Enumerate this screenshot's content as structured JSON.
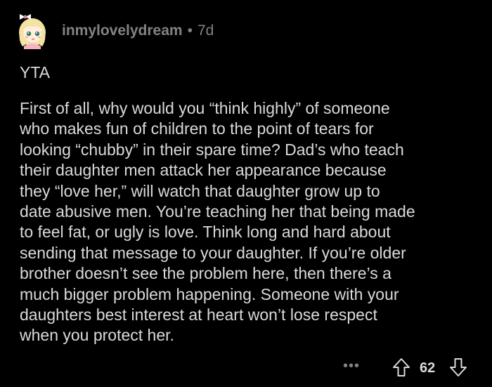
{
  "comment": {
    "username": "inmylovelydream",
    "separator": "•",
    "age": "7d",
    "verdict": "YTA",
    "body_lines": [
      "First of all, why would you “think highly” of someone",
      "who makes fun of children to the point of tears for",
      "looking “chubby” in their spare time? Dad’s who teach",
      "their daughter men attack her appearance because",
      "they “love her,” will watch that daughter grow up to",
      "date abusive men. You’re teaching her that being made",
      "to feel fat, or ugly is love. Think long and hard about",
      "sending that message to your daughter. If you’re older",
      "brother doesn’t see the problem here, then there’s a",
      "much bigger problem happening. Someone with your",
      "daughters best interest at heart won’t lose respect",
      "when you protect her."
    ],
    "actions": {
      "more_label": "•••",
      "score": "62",
      "upvote_icon": "arrow-up-outline-icon",
      "downvote_icon": "arrow-down-outline-icon"
    }
  },
  "colors": {
    "background": "#000000",
    "text": "#d7dadc",
    "meta": "#818384"
  }
}
